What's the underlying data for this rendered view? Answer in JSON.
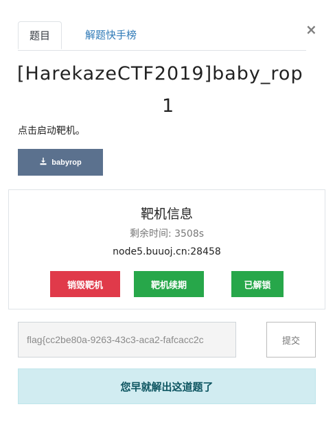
{
  "tabs": {
    "challenge_label": "题目",
    "leaderboard_label": "解题快手榜"
  },
  "title": {
    "line1": "[HarekazeCTF2019]baby_rop",
    "line2": "1"
  },
  "hint": "点击启动靶机。",
  "download_button": {
    "label": "babyrop"
  },
  "target_panel": {
    "title": "靶机信息",
    "time_left": "剩余时间: 3508s",
    "host": "node5.buuoj.cn:28458",
    "destroy_label": "销毁靶机",
    "renew_label": "靶机续期",
    "solved_label": "已解锁"
  },
  "flag": {
    "value": "flag{cc2be80a-9263-43c3-aca2-fafcacc2c",
    "submit_label": "提交"
  },
  "status_message": "您早就解出这道题了",
  "colors": {
    "danger": "#e03a4a",
    "success": "#27a74a",
    "download": "#5b718e",
    "alert_bg": "#d1ecf1",
    "alert_text": "#0c5460"
  }
}
